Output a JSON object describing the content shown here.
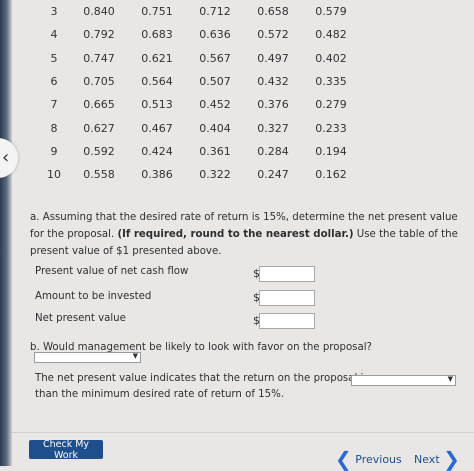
{
  "table": {
    "rows": [
      {
        "period": "3",
        "values": [
          "0.840",
          "0.751",
          "0.712",
          "0.658",
          "0.579"
        ]
      },
      {
        "period": "4",
        "values": [
          "0.792",
          "0.683",
          "0.636",
          "0.572",
          "0.482"
        ]
      },
      {
        "period": "5",
        "values": [
          "0.747",
          "0.621",
          "0.567",
          "0.497",
          "0.402"
        ]
      },
      {
        "period": "6",
        "values": [
          "0.705",
          "0.564",
          "0.507",
          "0.432",
          "0.335"
        ]
      },
      {
        "period": "7",
        "values": [
          "0.665",
          "0.513",
          "0.452",
          "0.376",
          "0.279"
        ]
      },
      {
        "period": "8",
        "values": [
          "0.627",
          "0.467",
          "0.404",
          "0.327",
          "0.233"
        ]
      },
      {
        "period": "9",
        "values": [
          "0.592",
          "0.424",
          "0.361",
          "0.284",
          "0.194"
        ]
      },
      {
        "period": "10",
        "values": [
          "0.558",
          "0.386",
          "0.322",
          "0.247",
          "0.162"
        ]
      }
    ]
  },
  "question_a": {
    "prefix": "a. Assuming that the desired rate of return is 15%, determine the net present value for the proposal.",
    "bold": "(If required, round to the nearest dollar.)",
    "suffix": "Use the table of the present value of $1 presented above.",
    "rows": [
      {
        "label": "Present value of net cash flow",
        "currency": "$",
        "value": ""
      },
      {
        "label": "Amount to be invested",
        "currency": "$",
        "value": ""
      },
      {
        "label": "Net present value",
        "currency": "$",
        "value": ""
      }
    ]
  },
  "question_b": {
    "text": "b. Would management be likely to look with favor on the proposal?",
    "select_value": "",
    "sentence_start": "The net present value indicates that the return on the proposal is",
    "sentence_end": "than the minimum desired rate of return of 15%.",
    "select2_value": ""
  },
  "footer": {
    "check_label": "Check My Work",
    "previous_label": "Previous",
    "next_label": "Next"
  }
}
